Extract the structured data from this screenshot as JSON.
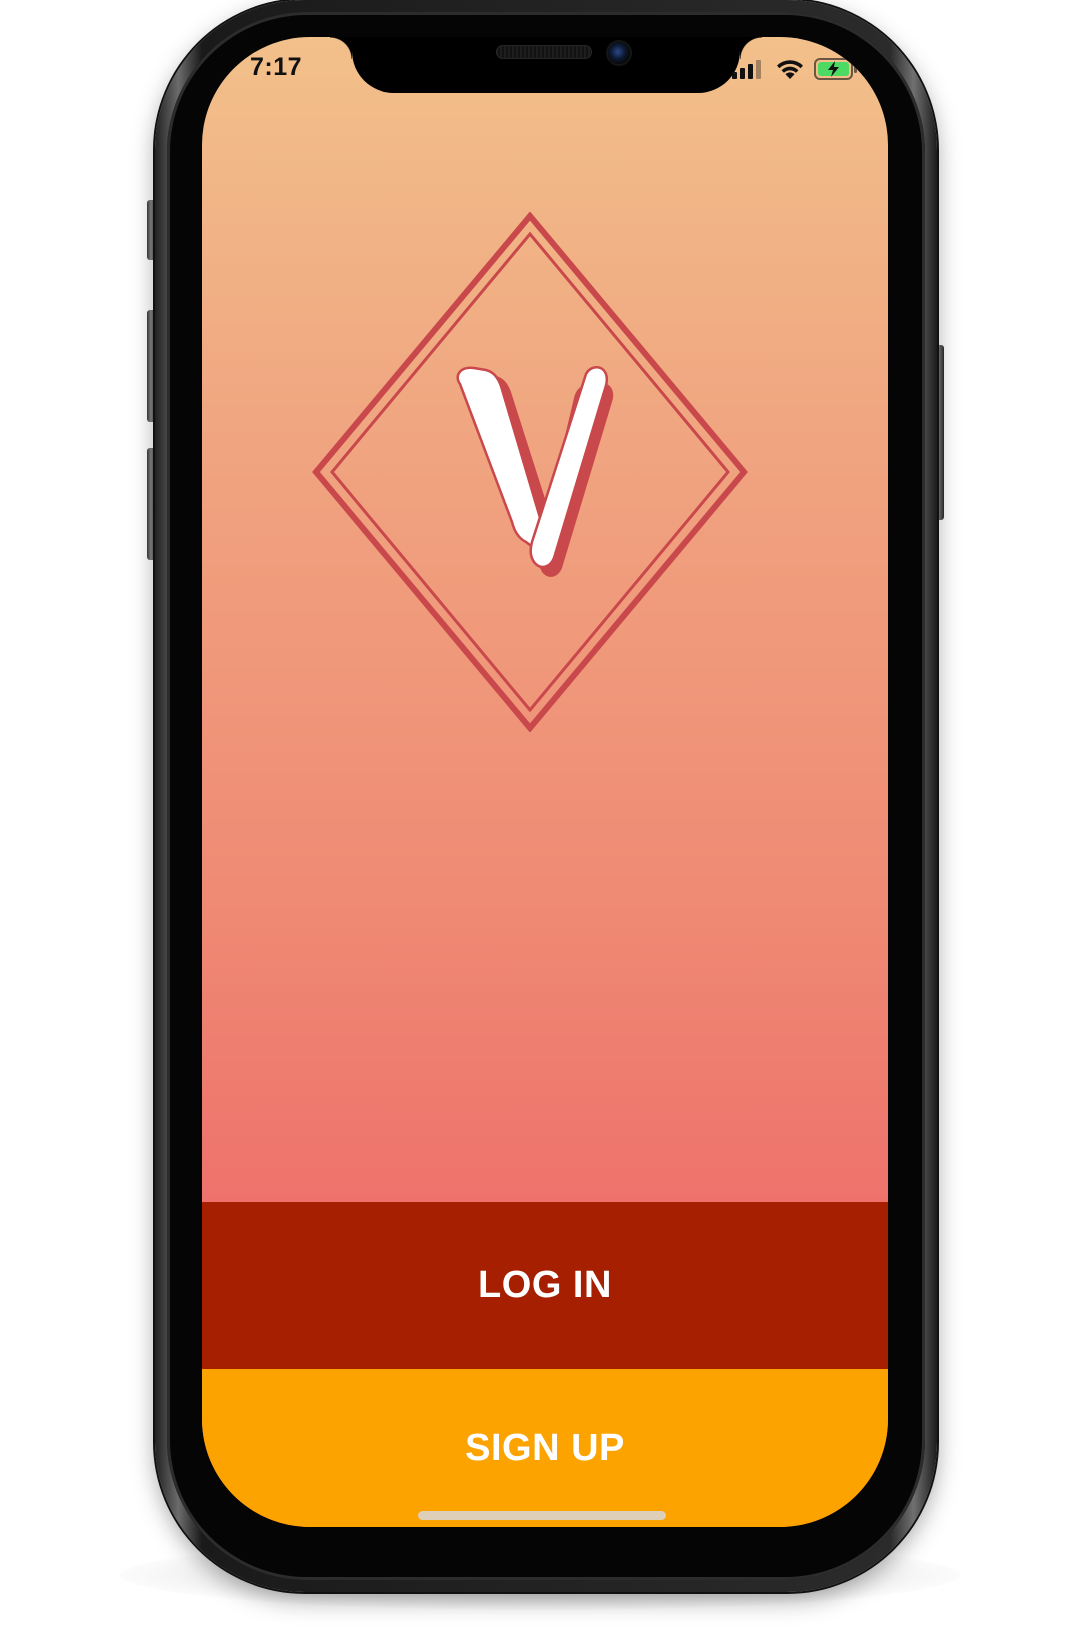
{
  "status_bar": {
    "time": "7:17",
    "icons": [
      "cellular-signal-icon",
      "wifi-icon",
      "battery-charging-icon"
    ]
  },
  "logo": {
    "letter": "V",
    "icon": "diamond-v-logo-icon"
  },
  "buttons": {
    "login_label": "LOG IN",
    "signup_label": "SIGN UP"
  },
  "colors": {
    "gradient_top": "#f2c08a",
    "gradient_bottom": "#ec5c62",
    "logo_stroke": "#c8484c",
    "login_background": "#a51f00",
    "signup_background": "#fca300",
    "battery_fill": "#4cd964"
  }
}
